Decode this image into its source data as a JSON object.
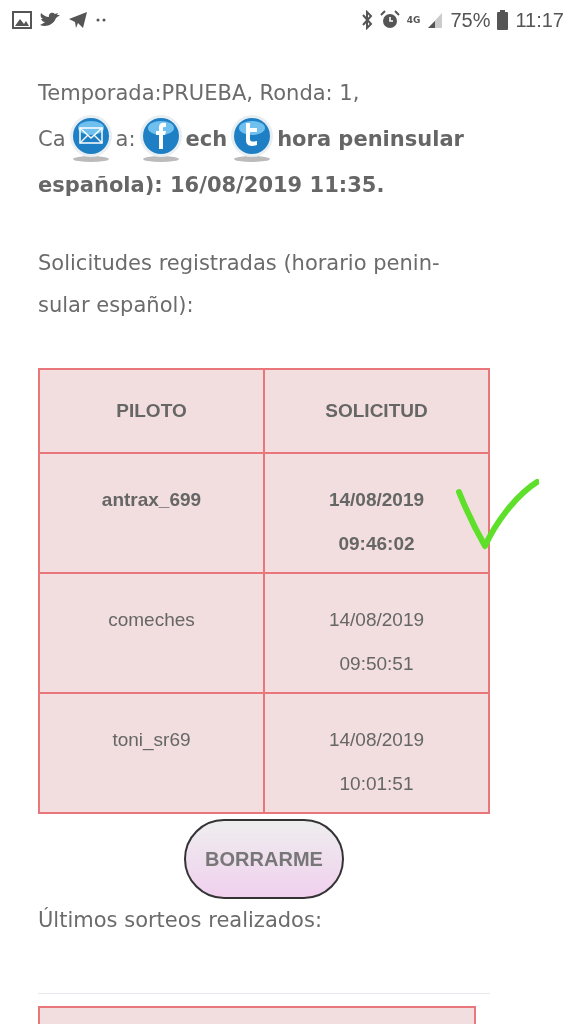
{
  "status_bar": {
    "battery": "75%",
    "time": "11:17",
    "network": "4G"
  },
  "intro": {
    "line_1": "Temporada:PRUEBA, Ronda: 1,",
    "line_2_parts": [
      {
        "text": "Ca",
        "bold": false
      },
      {
        "kind": "mail"
      },
      {
        "text": "a: ",
        "bold": false
      },
      {
        "kind": "facebook"
      },
      {
        "text": "ech",
        "bold": true
      },
      {
        "kind": "twitter"
      },
      {
        "text": "hora peninsular",
        "bold": true
      }
    ],
    "line_3": "española): 16/08/2019 11:35."
  },
  "requests_heading": "Solicitudes registradas (horario penin-sular español):",
  "table": {
    "columns": [
      "PILOTO",
      "SOLICITUD"
    ],
    "rows": [
      {
        "piloto": "antrax_699",
        "date": "14/08/2019",
        "time": "09:46:02",
        "highlighted": true,
        "checked": true
      },
      {
        "piloto": "comeches",
        "date": "14/08/2019",
        "time": "09:50:51",
        "highlighted": false,
        "checked": false
      },
      {
        "piloto": "toni_sr69",
        "date": "14/08/2019",
        "time": "10:01:51",
        "highlighted": false,
        "checked": false
      }
    ]
  },
  "delete_button": "BORRARME",
  "draws_heading": "Últimos sorteos realizados:"
}
